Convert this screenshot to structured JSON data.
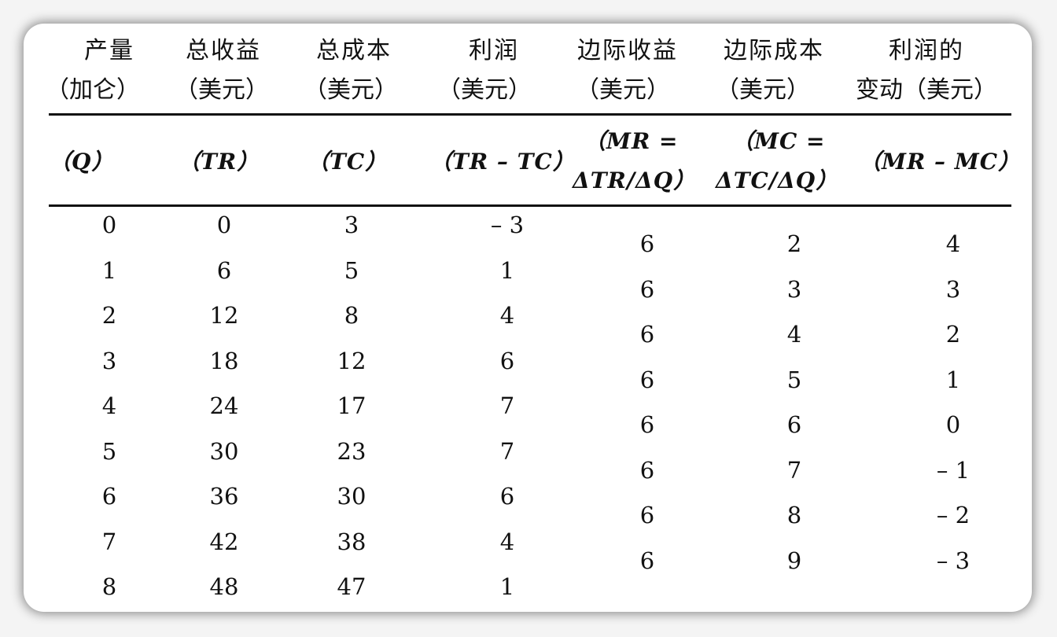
{
  "headers": [
    {
      "line1": "产量",
      "line2": "（加仑）",
      "sym": "（Q）",
      "sym2": ""
    },
    {
      "line1": "总收益",
      "line2": "（美元）",
      "sym": "（TR）",
      "sym2": ""
    },
    {
      "line1": "总成本",
      "line2": "（美元）",
      "sym": "（TC）",
      "sym2": ""
    },
    {
      "line1": "利润",
      "line2": "（美元）",
      "sym": "（TR – TC）",
      "sym2": ""
    },
    {
      "line1": "边际收益",
      "line2": "（美元）",
      "sym": "（MR =",
      "sym2": "ΔTR/ΔQ）"
    },
    {
      "line1": "边际成本",
      "line2": "（美元）",
      "sym": "（MC =",
      "sym2": "ΔTC/ΔQ）"
    },
    {
      "line1": "利润的",
      "line2": "变动（美元）",
      "sym": "（MR – MC）",
      "sym2": ""
    }
  ],
  "rows": [
    {
      "q": "0",
      "tr": "0",
      "tc": "3",
      "profit": "– 3"
    },
    {
      "q": "1",
      "tr": "6",
      "tc": "5",
      "profit": "1"
    },
    {
      "q": "2",
      "tr": "12",
      "tc": "8",
      "profit": "4"
    },
    {
      "q": "3",
      "tr": "18",
      "tc": "12",
      "profit": "6"
    },
    {
      "q": "4",
      "tr": "24",
      "tc": "17",
      "profit": "7"
    },
    {
      "q": "5",
      "tr": "30",
      "tc": "23",
      "profit": "7"
    },
    {
      "q": "6",
      "tr": "36",
      "tc": "30",
      "profit": "6"
    },
    {
      "q": "7",
      "tr": "42",
      "tc": "38",
      "profit": "4"
    },
    {
      "q": "8",
      "tr": "48",
      "tc": "47",
      "profit": "1"
    }
  ],
  "marginal_rows": [
    {
      "mr": "6",
      "mc": "2",
      "diff": "4"
    },
    {
      "mr": "6",
      "mc": "3",
      "diff": "3"
    },
    {
      "mr": "6",
      "mc": "4",
      "diff": "2"
    },
    {
      "mr": "6",
      "mc": "5",
      "diff": "1"
    },
    {
      "mr": "6",
      "mc": "6",
      "diff": "0"
    },
    {
      "mr": "6",
      "mc": "7",
      "diff": "– 1"
    },
    {
      "mr": "6",
      "mc": "8",
      "diff": "– 2"
    },
    {
      "mr": "6",
      "mc": "9",
      "diff": "– 3"
    }
  ]
}
